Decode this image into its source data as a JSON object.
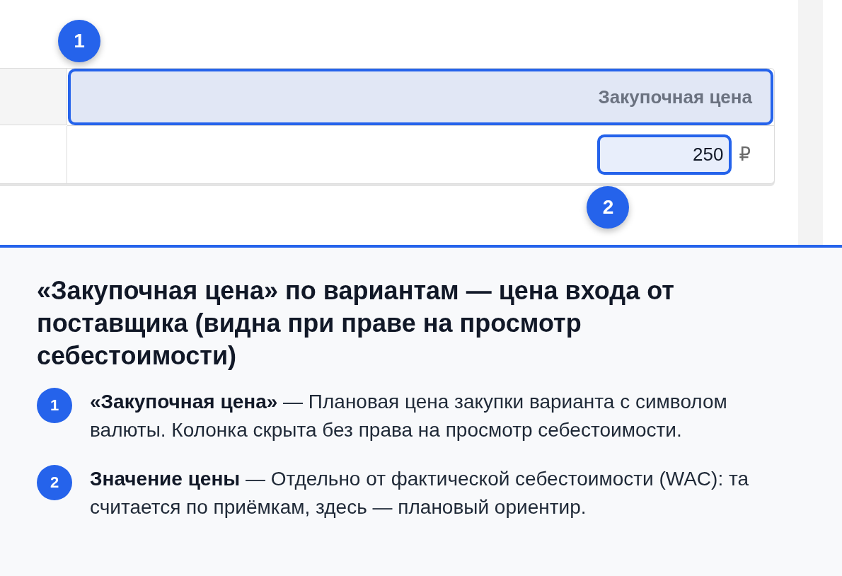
{
  "table": {
    "header": {
      "label": "Закупочная цена",
      "highlighted": true,
      "marker": "1"
    },
    "row": {
      "value": "250",
      "currency": "₽",
      "highlighted": true,
      "marker": "2"
    }
  },
  "explanation": {
    "title": "«Закупочная цена» по вариантам — цена входа от поставщика (видна при праве на просмотр себестоимости)",
    "items": [
      {
        "marker": "1",
        "text": "**«Закупочная цена»** — Плановая цена закупки варианта с символом валюты. Колонка скрыта без права на просмотр себестоимости."
      },
      {
        "marker": "2",
        "text": "**Значение цены** — Отдельно от фактической себестоимости (WAC): та считается по приёмкам, здесь — плановый ориентир."
      }
    ]
  }
}
